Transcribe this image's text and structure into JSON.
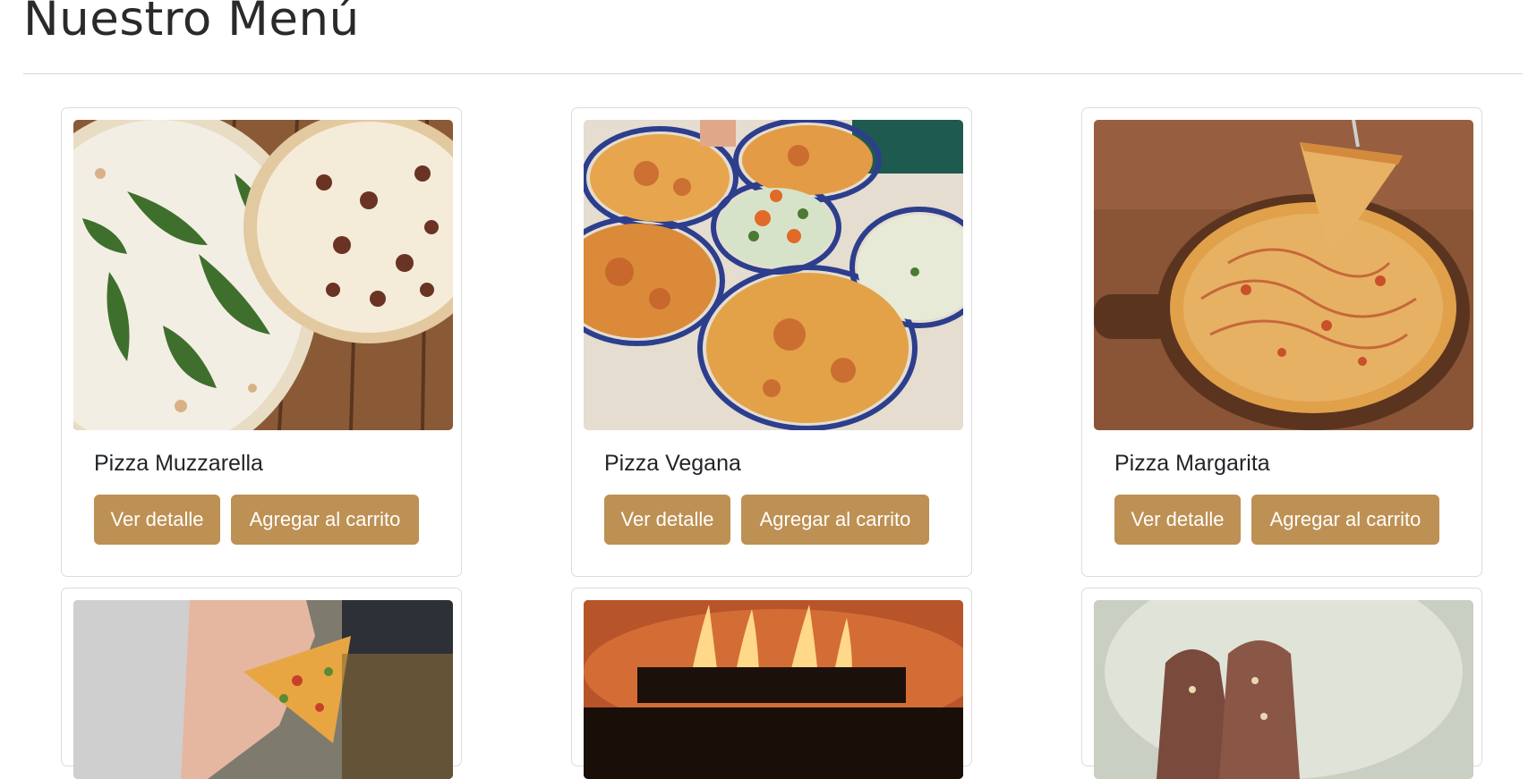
{
  "page": {
    "title": "Nuestro Menú"
  },
  "colors": {
    "button_bg": "#bd9053",
    "button_text": "#ffffff",
    "title": "#2a2a2a",
    "card_border": "#dcdcdc"
  },
  "products": [
    {
      "name": "Pizza Muzzarella",
      "image": "pizza-muzzarella-photo",
      "detail_label": "Ver detalle",
      "cart_label": "Agregar al carrito"
    },
    {
      "name": "Pizza Vegana",
      "image": "pizza-vegana-photo",
      "detail_label": "Ver detalle",
      "cart_label": "Agregar al carrito"
    },
    {
      "name": "Pizza Margarita",
      "image": "pizza-margarita-photo",
      "detail_label": "Ver detalle",
      "cart_label": "Agregar al carrito"
    },
    {
      "image": "pizza-slice-hand-photo"
    },
    {
      "image": "wood-oven-fire-photo"
    },
    {
      "image": "chocolate-dessert-photo"
    }
  ]
}
